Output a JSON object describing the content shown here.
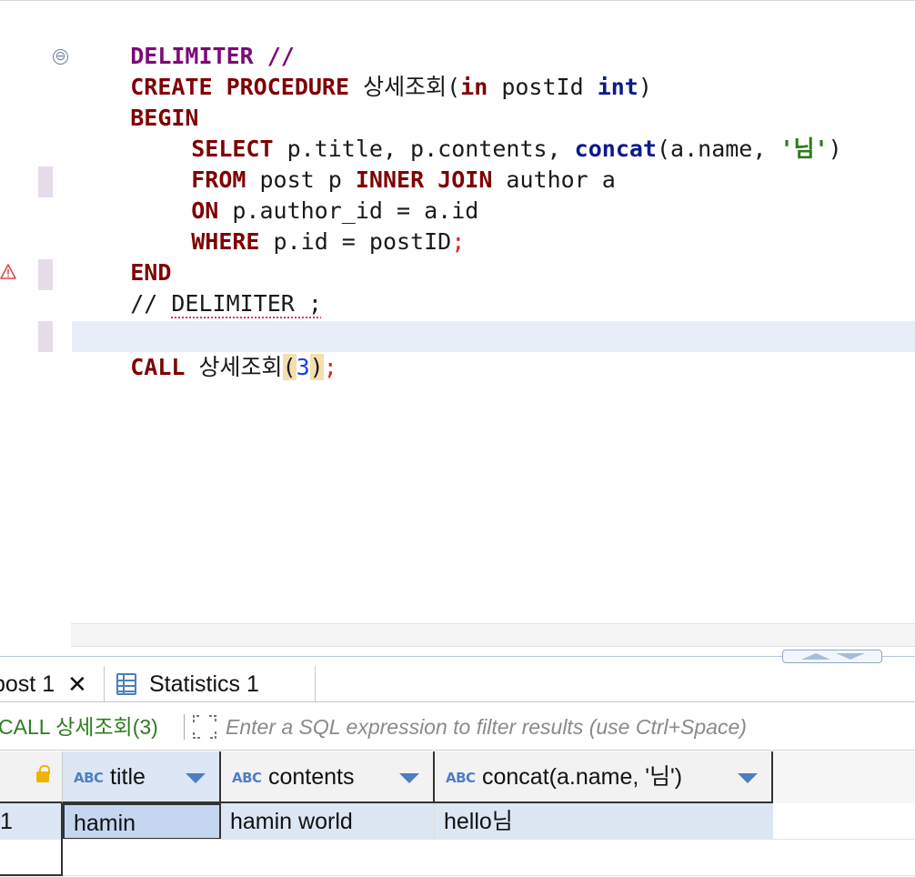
{
  "editor": {
    "lines": {
      "l1": {
        "kw": "DELIMITER //"
      },
      "l2": {
        "kw": "CREATE PROCEDURE",
        "name": " 상세조회(",
        "kw_in": "in",
        "param": " postId ",
        "kw_int": "int",
        "close": ")"
      },
      "l3": {
        "kw": "BEGIN"
      },
      "l4": {
        "kw": "SELECT",
        "cols": " p.title, p.contents, ",
        "fn": "concat",
        "args": "(a.name, ",
        "str": "'님'",
        "close": ")"
      },
      "l5": {
        "kw": "FROM",
        "t1": " post p ",
        "kw2": "INNER JOIN",
        "t2": " author a"
      },
      "l6": {
        "kw": "ON",
        "cond": " p.author_id = a.id"
      },
      "l7": {
        "kw": "WHERE",
        "cond": " p.id = postID",
        "semi": ";"
      },
      "l8": {
        "kw": "END"
      },
      "l9": {
        "prefix": "// ",
        "err_text": "DELIMITER ;"
      },
      "l10": {
        "kw": "CALL",
        "name": " 상세조회",
        "open": "(",
        "num": "3",
        "close": ")",
        "semi": ";"
      }
    },
    "fold_symbol": "⊖",
    "warning_icon": "warning-icon"
  },
  "result_tabs": [
    {
      "label": "post 1",
      "close": "✕"
    },
    {
      "label": "Statistics 1"
    }
  ],
  "filter": {
    "query_label": "CALL 상세조회(3)",
    "placeholder": "Enter a SQL expression to filter results (use Ctrl+Space)"
  },
  "grid": {
    "columns": [
      {
        "type": "ABC",
        "label": "title"
      },
      {
        "type": "ABC",
        "label": "contents"
      },
      {
        "type": "ABC",
        "label": "concat(a.name, '님')"
      }
    ],
    "rows": [
      {
        "num": "1",
        "cells": [
          "hamin",
          "hamin world",
          "hello님"
        ]
      }
    ]
  },
  "colors": {
    "keyword": "#7f0000",
    "delimiter": "#7b0a74",
    "type_keyword": "#0a1a8c",
    "string": "#2a7a1a",
    "number": "#1a3cf0",
    "query_label": "#2e7d1f",
    "selection": "#c4d6f0"
  }
}
